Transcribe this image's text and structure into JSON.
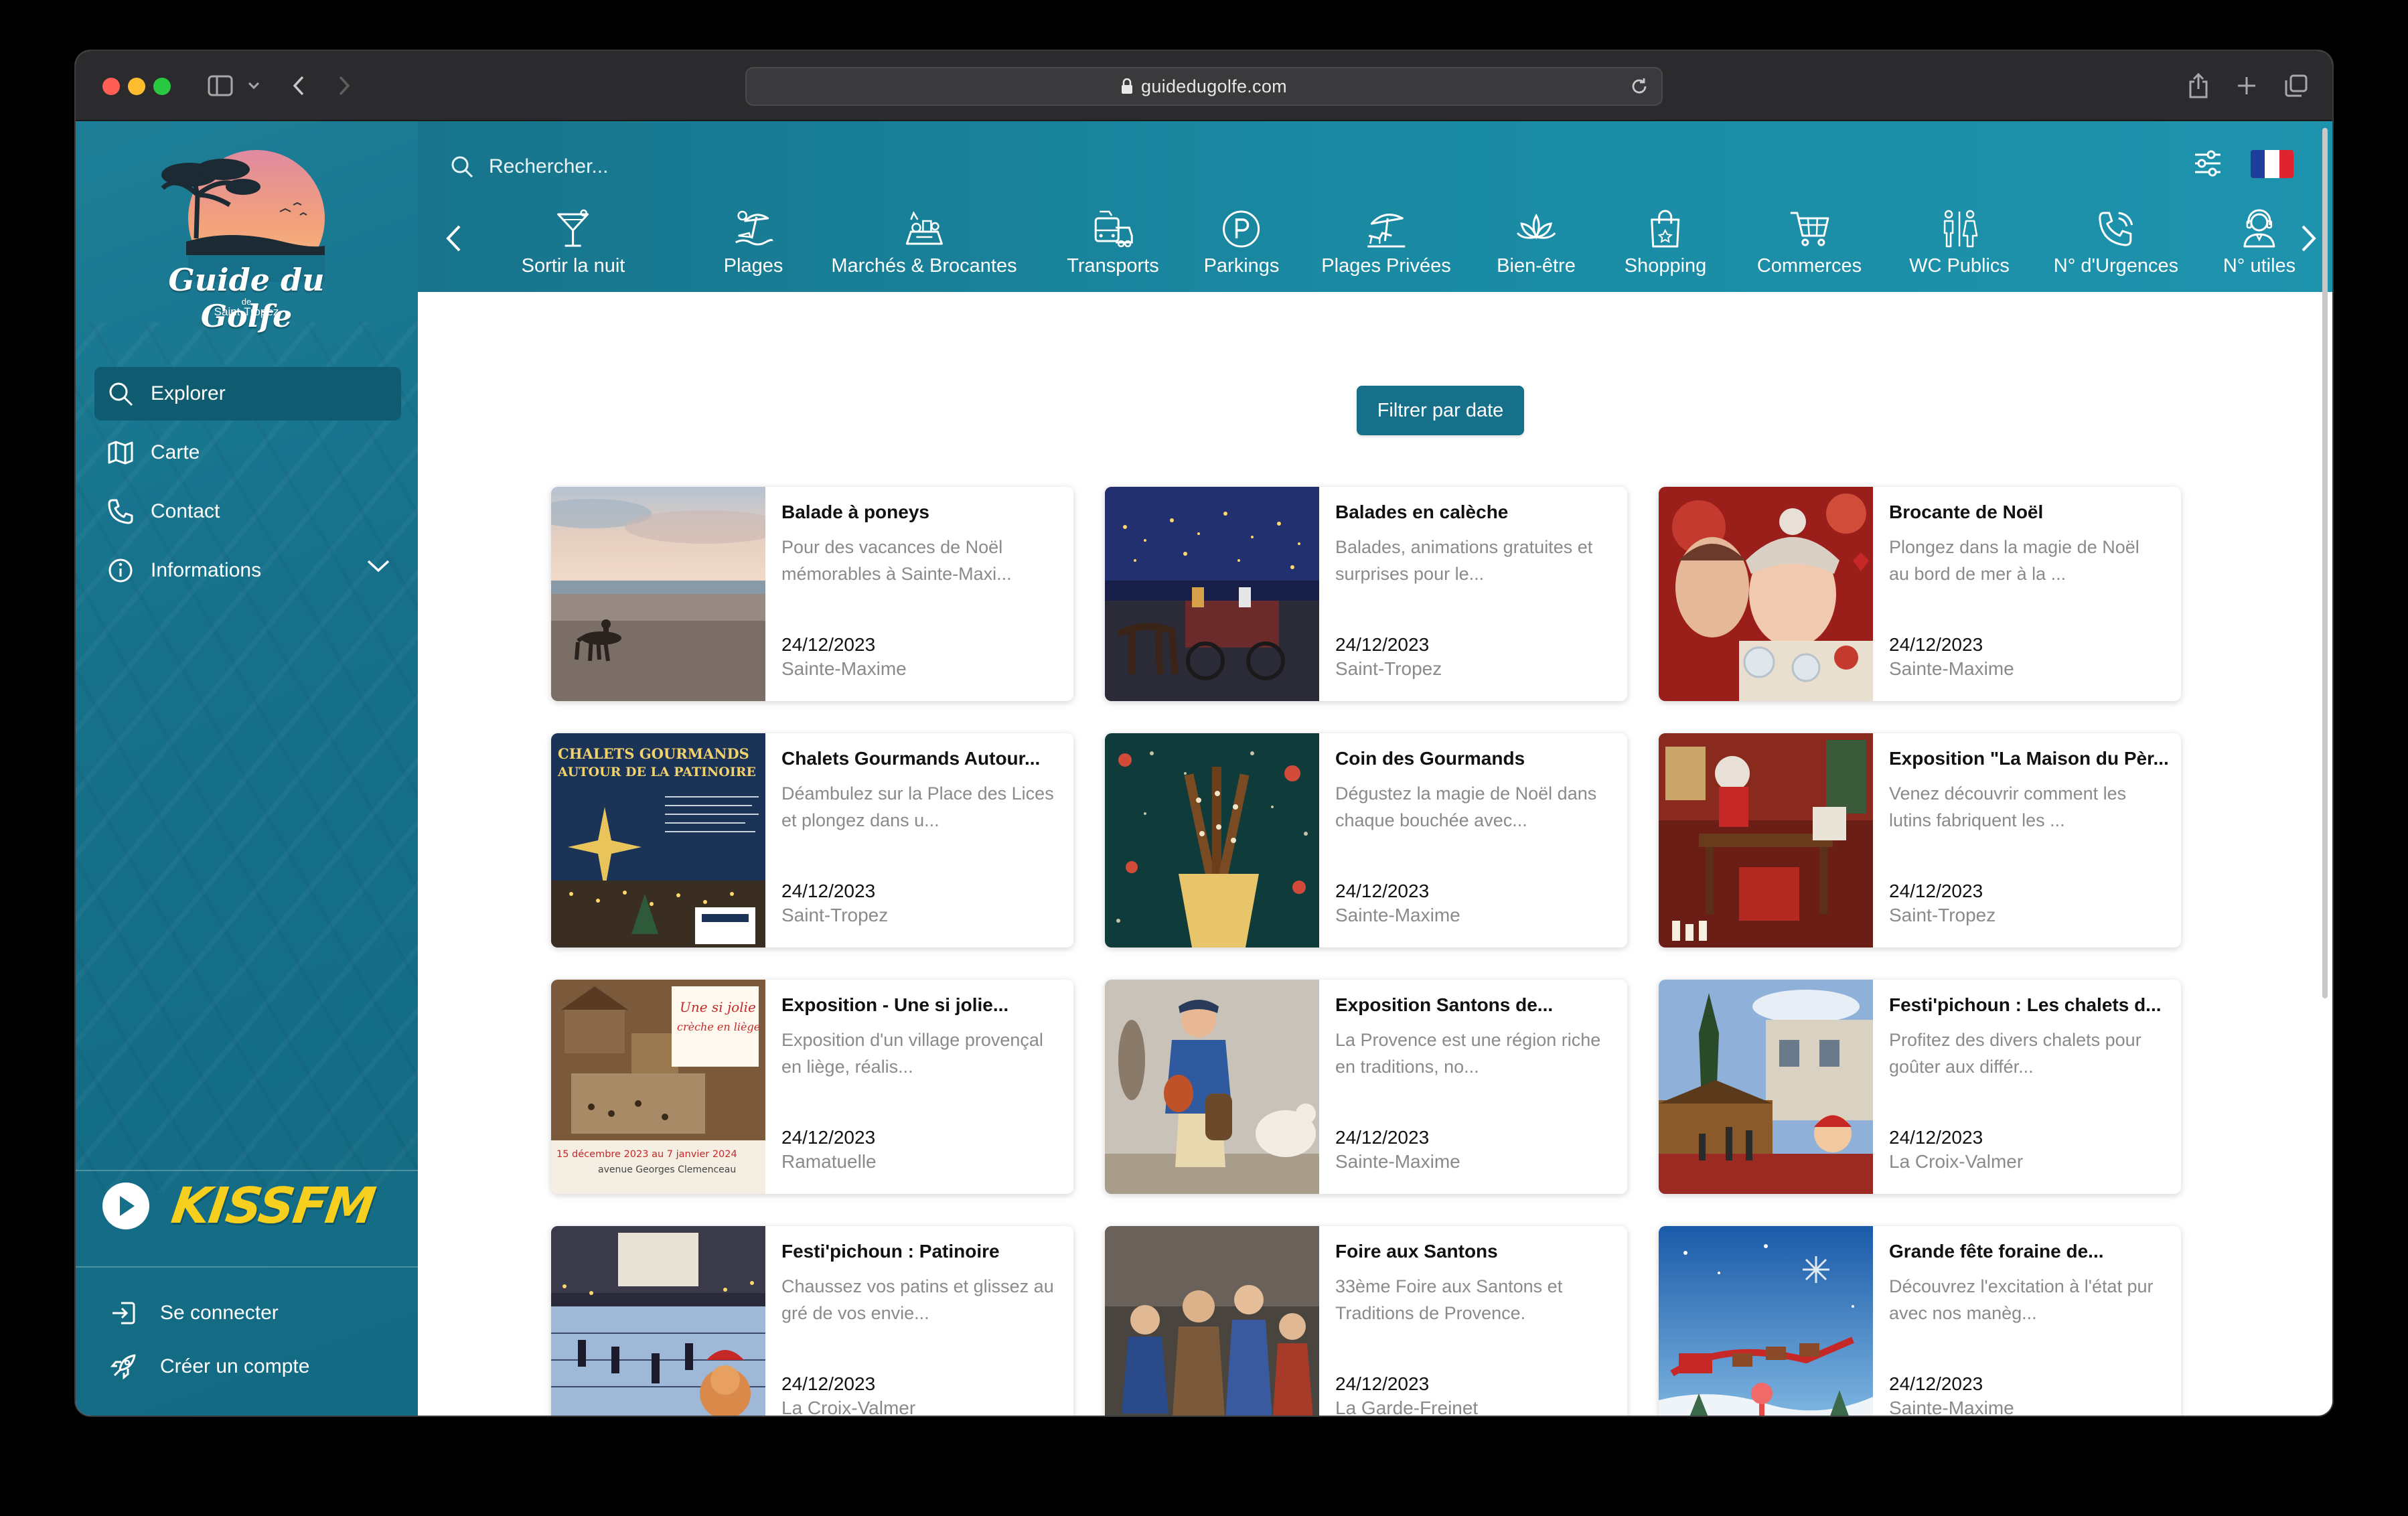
{
  "browser": {
    "url": "guidedugolfe.com"
  },
  "logo": {
    "title": "Guide du Golfe",
    "de": "de",
    "subtitle": "Saint-Tropez"
  },
  "sidebar": {
    "items": [
      {
        "label": "Explorer",
        "icon": "search-icon"
      },
      {
        "label": "Carte",
        "icon": "map-icon"
      },
      {
        "label": "Contact",
        "icon": "phone-icon"
      },
      {
        "label": "Informations",
        "icon": "info-icon"
      }
    ],
    "radio": {
      "brand": "KISSFM"
    },
    "auth": {
      "login": "Se connecter",
      "signup": "Créer un compte"
    }
  },
  "search": {
    "placeholder": "Rechercher..."
  },
  "categories": [
    {
      "label": "Sortir la nuit",
      "icon": "cocktail-icon"
    },
    {
      "label": "Plages",
      "icon": "beach-icon"
    },
    {
      "label": "Marchés & Brocantes",
      "icon": "market-icon"
    },
    {
      "label": "Transports",
      "icon": "transport-icon"
    },
    {
      "label": "Parkings",
      "icon": "parking-icon"
    },
    {
      "label": "Plages Privées",
      "icon": "private-beach-icon"
    },
    {
      "label": "Bien-être",
      "icon": "lotus-icon"
    },
    {
      "label": "Shopping",
      "icon": "shopping-bag-icon"
    },
    {
      "label": "Commerces",
      "icon": "cart-icon"
    },
    {
      "label": "WC Publics",
      "icon": "toilets-icon"
    },
    {
      "label": "N° d'Urgences",
      "icon": "emergency-phone-icon"
    },
    {
      "label": "N° utiles",
      "icon": "support-agent-icon"
    }
  ],
  "filter_button": "Filtrer par date",
  "events": [
    {
      "title": "Balade à poneys",
      "desc": "Pour des vacances de Noël mémorables à Sainte-Maxi...",
      "date": "24/12/2023",
      "location": "Sainte-Maxime"
    },
    {
      "title": "Balades en calèche",
      "desc": "Balades, animations gratuites et surprises pour le...",
      "date": "24/12/2023",
      "location": "Saint-Tropez"
    },
    {
      "title": "Brocante de Noël",
      "desc": "Plongez dans la magie de Noël au bord de mer à la ...",
      "date": "24/12/2023",
      "location": "Sainte-Maxime"
    },
    {
      "title": "Chalets Gourmands Autour...",
      "desc": "Déambulez sur la Place des Lices et plongez dans u...",
      "date": "24/12/2023",
      "location": "Saint-Tropez"
    },
    {
      "title": "Coin des Gourmands",
      "desc": "Dégustez la magie de Noël dans chaque bouchée avec...",
      "date": "24/12/2023",
      "location": "Sainte-Maxime"
    },
    {
      "title": "Exposition \"La Maison du Pèr...",
      "desc": "Venez découvrir comment les lutins fabriquent les ...",
      "date": "24/12/2023",
      "location": "Saint-Tropez"
    },
    {
      "title": "Exposition - Une si jolie...",
      "desc": "Exposition d'un village provençal en liège, réalis...",
      "date": "24/12/2023",
      "location": "Ramatuelle"
    },
    {
      "title": "Exposition Santons de...",
      "desc": "La Provence est une région riche en traditions, no...",
      "date": "24/12/2023",
      "location": "Sainte-Maxime"
    },
    {
      "title": "Festi'pichoun : Les chalets d...",
      "desc": "Profitez des divers chalets pour goûter aux différ...",
      "date": "24/12/2023",
      "location": "La Croix-Valmer"
    },
    {
      "title": "Festi'pichoun : Patinoire",
      "desc": "Chaussez vos patins et glissez au gré de vos envie...",
      "date": "24/12/2023",
      "location": "La Croix-Valmer"
    },
    {
      "title": "Foire aux Santons",
      "desc": "33ème Foire aux Santons et Traditions de Provence.",
      "date": "24/12/2023",
      "location": "La Garde-Freinet"
    },
    {
      "title": "Grande fête foraine de...",
      "desc": "Découvrez l'excitation à l'état pur avec nos manèg...",
      "date": "24/12/2023",
      "location": "Sainte-Maxime"
    }
  ],
  "thumb_text": {
    "chalets": [
      "CHALETS GOURMANDS",
      "AUTOUR DE LA PATINOIRE"
    ],
    "expo": [
      "Une si jolie",
      "crèche en liège",
      "15 décembre 2023 au 7 janvier 2024",
      "avenue Georges Clemenceau"
    ]
  },
  "colors": {
    "brand": "#17708a",
    "sidebar": "#16708a",
    "kiss": "#f7cf1e"
  }
}
